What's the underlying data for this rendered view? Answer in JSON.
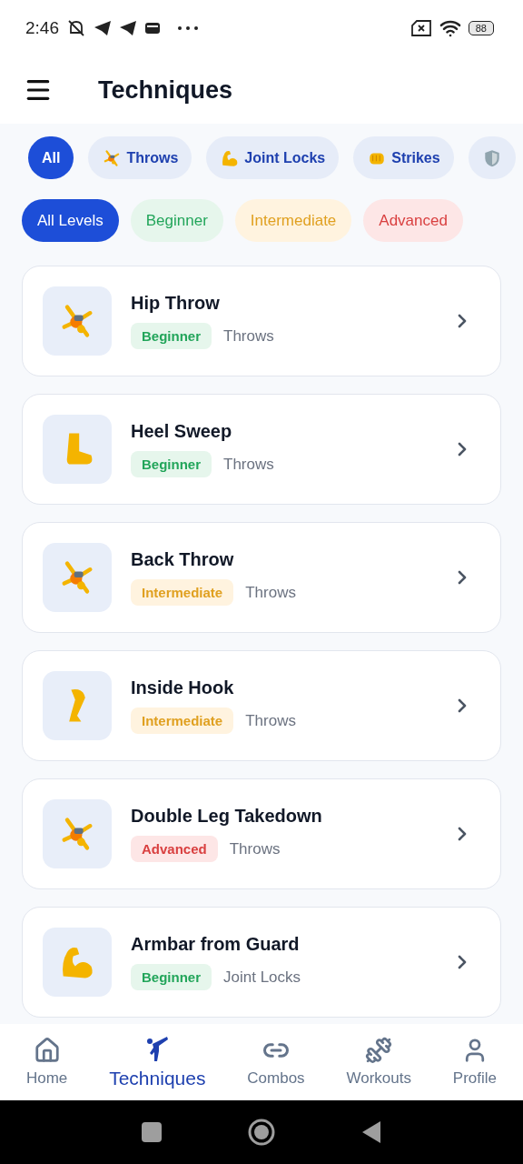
{
  "status_bar": {
    "time": "2:46",
    "battery": "88"
  },
  "header": {
    "title": "Techniques"
  },
  "categories": [
    {
      "label": "All",
      "kind": "none",
      "selected": true
    },
    {
      "label": "Throws",
      "kind": "cartwheel",
      "selected": false
    },
    {
      "label": "Joint Locks",
      "kind": "arm",
      "selected": false
    },
    {
      "label": "Strikes",
      "kind": "fist",
      "selected": false
    },
    {
      "kind": "shield",
      "selected": false
    }
  ],
  "levels": [
    {
      "label": "All Levels",
      "kind": "all",
      "selected": true
    },
    {
      "label": "Beginner",
      "kind": "beginner",
      "selected": false
    },
    {
      "label": "Intermediate",
      "kind": "intermediate",
      "selected": false
    },
    {
      "label": "Advanced",
      "kind": "advanced",
      "selected": false
    }
  ],
  "techniques": [
    {
      "name": "Hip Throw",
      "kind": "cartwheel",
      "level": {
        "label": "Beginner",
        "kind": "beginner"
      },
      "category": "Throws"
    },
    {
      "name": "Heel Sweep",
      "kind": "foot",
      "level": {
        "label": "Beginner",
        "kind": "beginner"
      },
      "category": "Throws"
    },
    {
      "name": "Back Throw",
      "kind": "cartwheel",
      "level": {
        "label": "Intermediate",
        "kind": "intermediate"
      },
      "category": "Throws"
    },
    {
      "name": "Inside Hook",
      "kind": "leg",
      "level": {
        "label": "Intermediate",
        "kind": "intermediate"
      },
      "category": "Throws"
    },
    {
      "name": "Double Leg Takedown",
      "kind": "cartwheel",
      "level": {
        "label": "Advanced",
        "kind": "advanced"
      },
      "category": "Throws"
    },
    {
      "name": "Armbar from Guard",
      "kind": "arm",
      "level": {
        "label": "Beginner",
        "kind": "beginner"
      },
      "category": "Joint Locks"
    }
  ],
  "bottom_nav": [
    {
      "label": "Home",
      "kind": "home",
      "selected": false
    },
    {
      "label": "Techniques",
      "kind": "kick",
      "selected": true
    },
    {
      "label": "Combos",
      "kind": "link",
      "selected": false
    },
    {
      "label": "Workouts",
      "kind": "dumbbell",
      "selected": false
    },
    {
      "label": "Profile",
      "kind": "user",
      "selected": false
    }
  ]
}
